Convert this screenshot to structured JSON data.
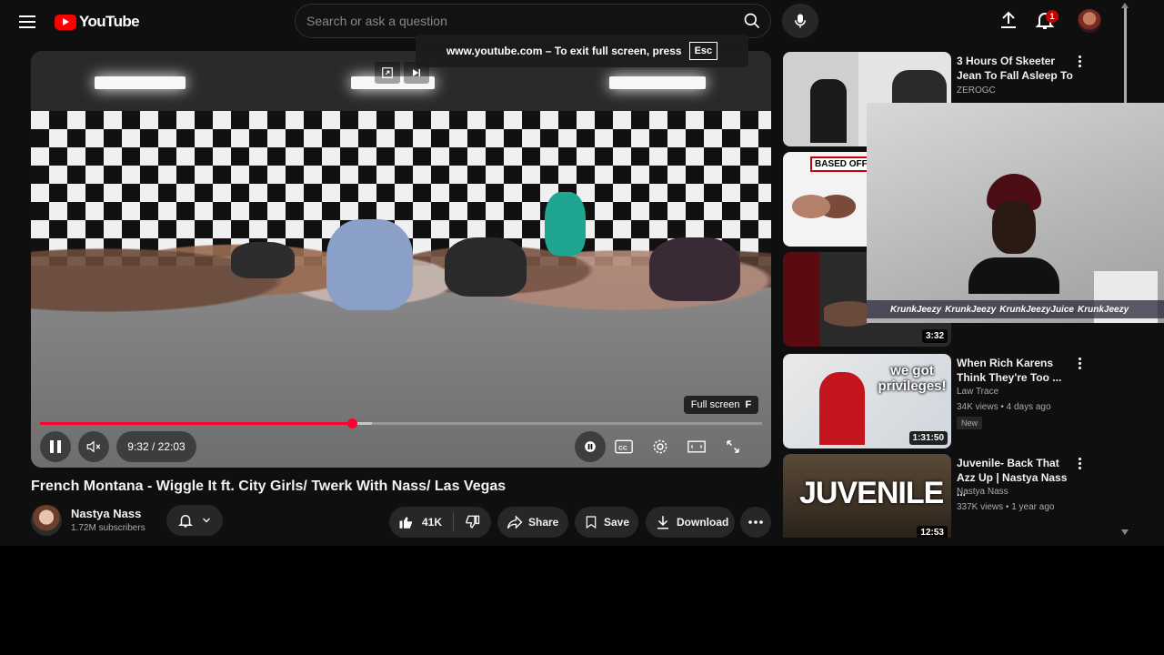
{
  "header": {
    "logo_text": "YouTube",
    "search_placeholder": "Search or ask a question",
    "notification_count": "1"
  },
  "fullscreen_toast": {
    "text": "www.youtube.com – To exit full screen, press",
    "key": "Esc"
  },
  "player": {
    "fullscreen_tip": "Full screen",
    "fullscreen_key": "F",
    "current_time": "9:32",
    "duration": "22:03",
    "time_display": "9:32 / 22:03",
    "progress_fraction": 0.432,
    "buffer_fraction": 0.46
  },
  "video": {
    "title": "French Montana - Wiggle It ft. City Girls/ Twerk With Nass/ Las Vegas",
    "channel": "Nastya Nass",
    "subscribers": "1.72M subscribers"
  },
  "actions": {
    "likes": "41K",
    "share": "Share",
    "save": "Save",
    "download": "Download"
  },
  "sidebar": {
    "items": [
      {
        "title": "3 Hours Of Skeeter Jean To Fall Asleep To",
        "channel": "ZEROGC",
        "views": "",
        "duration": "",
        "badge": ""
      },
      {
        "title": "",
        "channel": "",
        "views": "",
        "duration": "",
        "badge": "",
        "thumb_text": "BASED OFF"
      },
      {
        "title": "",
        "channel": "",
        "views": "",
        "duration": "3:32",
        "badge": ""
      },
      {
        "title": "When Rich Karens Think They're Too ...",
        "channel": "Law Trace",
        "views": "34K views • 4 days ago",
        "duration": "1:31:50",
        "badge": "New",
        "thumb_text": "we got privileges!"
      },
      {
        "title": "Juvenile- Back That Azz Up | Nastya Nass ...",
        "channel": "Nastya Nass",
        "views": "337K views • 1 year ago",
        "duration": "12:53",
        "badge": "",
        "thumb_text": "JUVENILE"
      }
    ]
  },
  "webcam": {
    "handles": [
      "KrunkJeezy",
      "KrunkJeezy",
      "KrunkJeezyJuice",
      "KrunkJeezy"
    ]
  },
  "colors": {
    "accent": "#ff0033",
    "background": "#0f0f0f",
    "pill": "#272727"
  }
}
